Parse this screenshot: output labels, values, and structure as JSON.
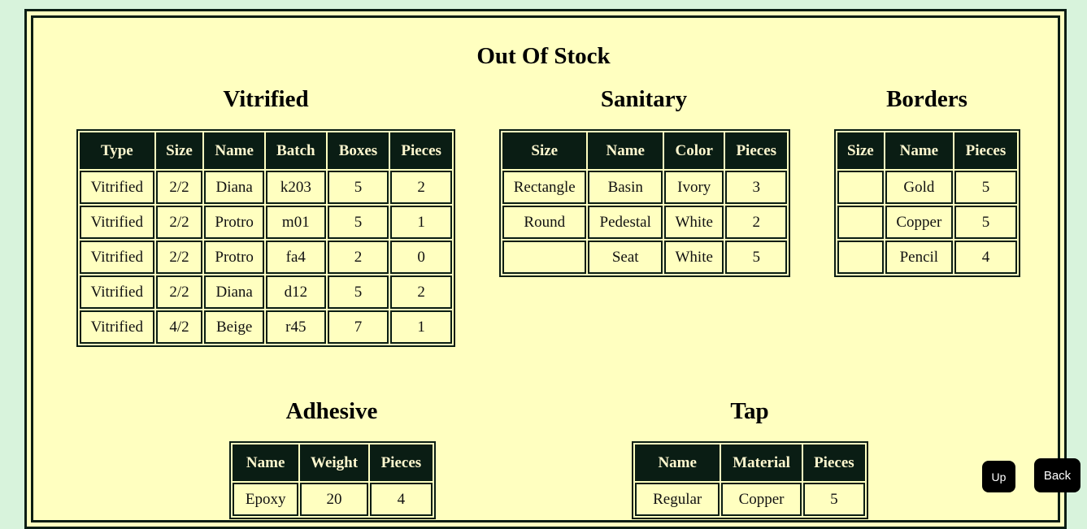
{
  "page": {
    "title": "Out Of Stock"
  },
  "sections": {
    "vitrified": {
      "title": "Vitrified",
      "headers": [
        "Type",
        "Size",
        "Name",
        "Batch",
        "Boxes",
        "Pieces"
      ],
      "rows": [
        [
          "Vitrified",
          "2/2",
          "Diana",
          "k203",
          "5",
          "2"
        ],
        [
          "Vitrified",
          "2/2",
          "Protro",
          "m01",
          "5",
          "1"
        ],
        [
          "Vitrified",
          "2/2",
          "Protro",
          "fa4",
          "2",
          "0"
        ],
        [
          "Vitrified",
          "2/2",
          "Diana",
          "d12",
          "5",
          "2"
        ],
        [
          "Vitrified",
          "4/2",
          "Beige",
          "r45",
          "7",
          "1"
        ]
      ]
    },
    "sanitary": {
      "title": "Sanitary",
      "headers": [
        "Size",
        "Name",
        "Color",
        "Pieces"
      ],
      "rows": [
        [
          "Rectangle",
          "Basin",
          "Ivory",
          "3"
        ],
        [
          "Round",
          "Pedestal",
          "White",
          "2"
        ],
        [
          "",
          "Seat",
          "White",
          "5"
        ]
      ]
    },
    "borders": {
      "title": "Borders",
      "headers": [
        "Size",
        "Name",
        "Pieces"
      ],
      "rows": [
        [
          "",
          "Gold",
          "5"
        ],
        [
          "",
          "Copper",
          "5"
        ],
        [
          "",
          "Pencil",
          "4"
        ]
      ]
    },
    "adhesive": {
      "title": "Adhesive",
      "headers": [
        "Name",
        "Weight",
        "Pieces"
      ],
      "rows": [
        [
          "Epoxy",
          "20",
          "4"
        ]
      ]
    },
    "tap": {
      "title": "Tap",
      "headers": [
        "Name",
        "Material",
        "Pieces"
      ],
      "rows": [
        [
          "Regular",
          "Copper",
          "5"
        ]
      ]
    }
  },
  "buttons": {
    "up": "Up",
    "back": "Back"
  },
  "colors": {
    "page_bg": "#d8f3dc",
    "panel_bg": "#ffffc0",
    "header_bg": "#0a1d14",
    "header_text": "#fff8cf"
  }
}
